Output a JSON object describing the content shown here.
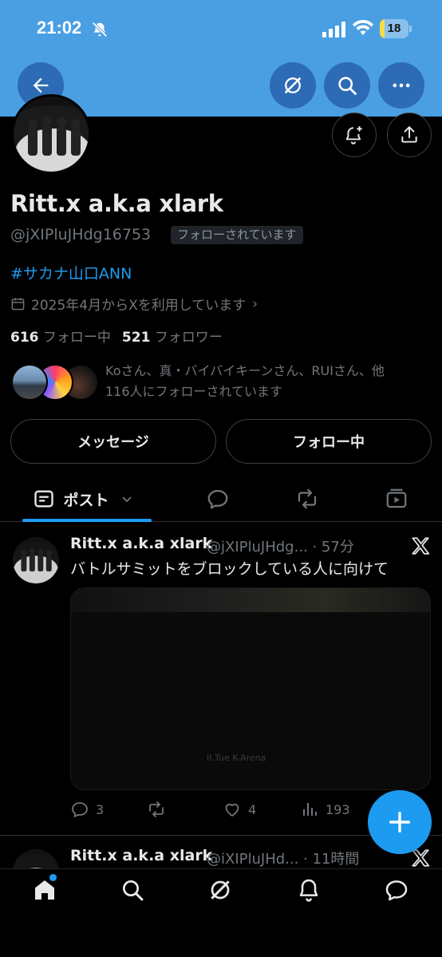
{
  "status_bar": {
    "time": "21:02",
    "battery": "18",
    "battery_level": 0.18
  },
  "top_actions": {
    "back": "back-arrow-icon",
    "grok": "grok-icon",
    "search": "search-icon",
    "more": "more-dots-icon"
  },
  "profile": {
    "display_name": "Ritt.x a.k.a xlark",
    "handle": "@jXIPluJHdg16753",
    "follows_you_badge": "フォローされています",
    "bio_hashtag": "#サカナ山口ANN",
    "joined": "2025年4月からXを利用しています",
    "following_count": "616",
    "following_label": "フォロー中",
    "followers_count": "521",
    "followers_label": "フォロワー",
    "followed_by_line1": "Koさん、真・バイバイキーンさん、RUIさん、他",
    "followed_by_line2": "116人にフォローされています",
    "message_button": "メッセージ",
    "following_button": "フォロー中"
  },
  "tabs": {
    "posts_label": "ポスト"
  },
  "tweets": [
    {
      "name": "Ritt.x a.k.a xlark",
      "handle_time": "@jXIPluJHdg... · 57分",
      "text": "バトルサミットをブロックしている人に向けて",
      "replies": "3",
      "retweets": "",
      "likes": "4",
      "views": "193",
      "media_caption": "II.Tue  K-Arena"
    },
    {
      "name": "Ritt.x a.k.a xlark",
      "handle_time": "@iXIPluJHd... · 11時間"
    }
  ],
  "colors": {
    "accent": "#1d9bf0",
    "header": "#4a9fe3",
    "header_button": "#2d6bb6",
    "background": "#000000",
    "muted": "#71767b"
  }
}
